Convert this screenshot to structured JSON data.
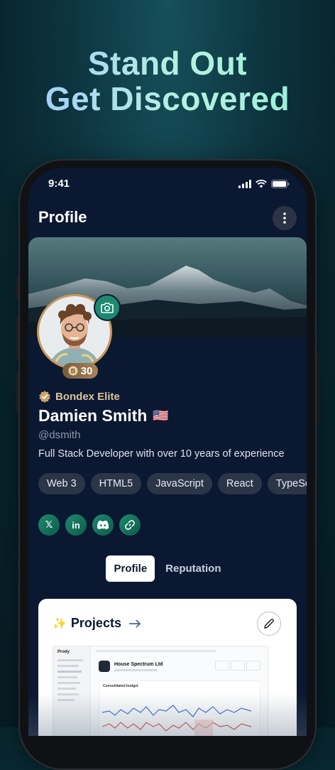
{
  "headline": {
    "line1": "Stand Out",
    "line2": "Get Discovered"
  },
  "status_bar": {
    "time": "9:41"
  },
  "page": {
    "title": "Profile"
  },
  "profile": {
    "level": "30",
    "badge_label": "Bondex Elite",
    "name": "Damien Smith",
    "flag": "🇺🇸",
    "handle": "@dsmith",
    "bio": "Full Stack Developer with over 10 years of experience",
    "tags": [
      "Web 3",
      "HTML5",
      "JavaScript",
      "React",
      "TypeScript"
    ]
  },
  "socials": [
    {
      "label": "𝕏",
      "icon": "x-icon"
    },
    {
      "label": "in",
      "icon": "linkedin-icon"
    },
    {
      "label": "",
      "icon": "discord-icon"
    },
    {
      "label": "",
      "icon": "link-icon"
    }
  ],
  "tabs": [
    {
      "label": "Profile",
      "active": true
    },
    {
      "label": "Reputation",
      "active": false
    }
  ],
  "projects": {
    "title": "Projects",
    "preview": {
      "app": "Prody",
      "project_name": "House Spectrum Ltd",
      "section": "Consolidated budget"
    }
  },
  "colors": {
    "accent": "#1c8a6e",
    "background": "#0b1831",
    "elite": "#dcc39c"
  }
}
